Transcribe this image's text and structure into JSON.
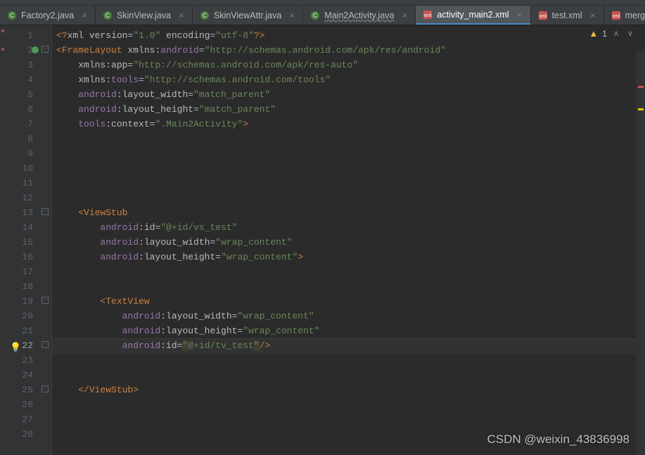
{
  "tabs": [
    {
      "label": "Factory2.java",
      "type": "class",
      "active": false
    },
    {
      "label": "SkinView.java",
      "type": "class",
      "active": false
    },
    {
      "label": "SkinViewAttr.java",
      "type": "class",
      "active": false
    },
    {
      "label": "Main2Activity.java",
      "type": "class",
      "active": false,
      "underline": true
    },
    {
      "label": "activity_main2.xml",
      "type": "xml",
      "active": true
    },
    {
      "label": "test.xml",
      "type": "xml",
      "active": false
    },
    {
      "label": "merge.xml",
      "type": "xml",
      "active": false
    }
  ],
  "warnings": {
    "count": "1"
  },
  "code": {
    "l1": {
      "a": "<?",
      "b": "xml version",
      "c": "=",
      "d": "\"1.0\"",
      "e": " encoding",
      "f": "=",
      "g": "\"utf-8\"",
      "h": "?>"
    },
    "l2": {
      "a": "<",
      "b": "FrameLayout ",
      "c": "xmlns:",
      "d": "android",
      "e": "=",
      "f": "\"http://schemas.android.com/apk/res/android\""
    },
    "l3": {
      "a": "xmlns:app=",
      "b": "\"http://schemas.android.com/apk/res-auto\""
    },
    "l4": {
      "a": "xmlns:",
      "b": "tools",
      "c": "=",
      "d": "\"http://schemas.android.com/tools\""
    },
    "l5": {
      "a": "android",
      "b": ":layout_width",
      "c": "=",
      "d": "\"match_parent\""
    },
    "l6": {
      "a": "android",
      "b": ":layout_height",
      "c": "=",
      "d": "\"match_parent\""
    },
    "l7": {
      "a": "tools",
      "b": ":context",
      "c": "=",
      "d": "\".Main2Activity\"",
      "e": ">"
    },
    "l13": {
      "a": "<",
      "b": "ViewStub"
    },
    "l14": {
      "a": "android",
      "b": ":id",
      "c": "=",
      "d": "\"@+id/vs_test\""
    },
    "l15": {
      "a": "android",
      "b": ":layout_width",
      "c": "=",
      "d": "\"wrap_content\""
    },
    "l16": {
      "a": "android",
      "b": ":layout_height",
      "c": "=",
      "d": "\"wrap_content\"",
      "e": ">"
    },
    "l19": {
      "a": "<",
      "b": "TextView"
    },
    "l20": {
      "a": "android",
      "b": ":layout_width",
      "c": "=",
      "d": "\"wrap_content\""
    },
    "l21": {
      "a": "android",
      "b": ":layout_height",
      "c": "=",
      "d": "\"wrap_content\""
    },
    "l22": {
      "a": "android",
      "b": ":id",
      "c": "=",
      "dq": "\"",
      "d": "@+id/tv_test",
      "eq": "\"",
      "e": "/>"
    },
    "l25": {
      "a": "</",
      "b": "ViewStub",
      "c": ">"
    }
  },
  "watermark": "CSDN @weixin_43836998"
}
